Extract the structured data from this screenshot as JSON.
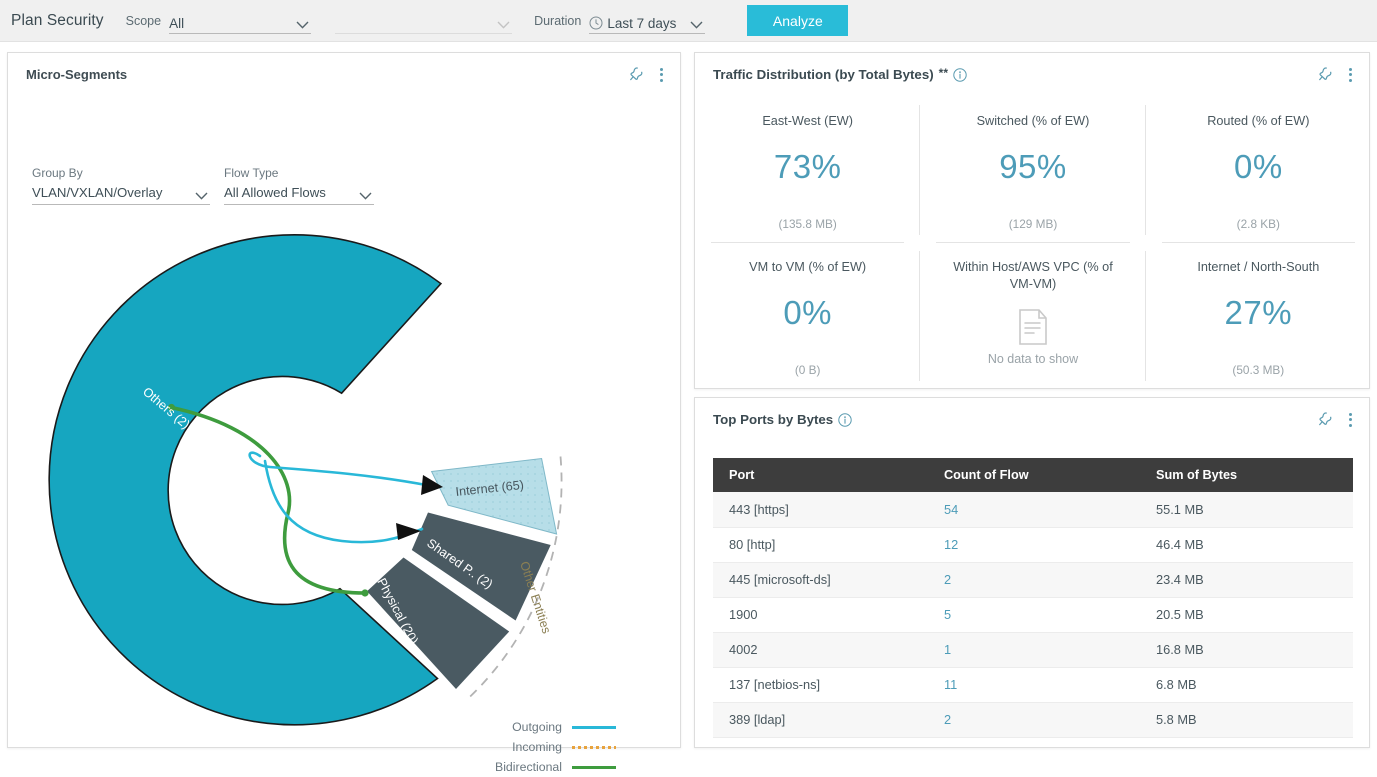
{
  "topbar": {
    "title": "Plan Security",
    "scope_label": "Scope",
    "scope_value": "All",
    "scope_secondary_value": "",
    "duration_label": "Duration",
    "duration_value": "Last 7 days",
    "analyze_label": "Analyze"
  },
  "microsegments": {
    "title": "Micro-Segments",
    "group_by_label": "Group By",
    "group_by_value": "VLAN/VXLAN/Overlay",
    "flow_type_label": "Flow Type",
    "flow_type_value": "All Allowed Flows",
    "outer_ring_label": "Other Entities",
    "legend": [
      {
        "label": "Outgoing",
        "color": "#29b8d8",
        "style": "solid"
      },
      {
        "label": "Incoming",
        "color": "#e8a33d",
        "style": "dashed"
      },
      {
        "label": "Bidirectional",
        "color": "#3e9c3e",
        "style": "solid"
      }
    ],
    "chart_data": {
      "type": "pie",
      "title": "Micro-Segments",
      "segments": [
        {
          "label": "Others (2)",
          "name": "Others",
          "count": 2,
          "value": 255,
          "color": "#16a6c0",
          "text_color": "#ffffff",
          "ring": "inner"
        },
        {
          "label": "Internet (65)",
          "name": "Internet",
          "count": 65,
          "value": 33,
          "color": "#b7dee8",
          "text_color": "#4a585f",
          "ring": "outer"
        },
        {
          "label": "Shared P.. (2)",
          "name": "Shared P..",
          "count": 2,
          "value": 36,
          "color": "#4a5a62",
          "text_color": "#ffffff",
          "ring": "outer"
        },
        {
          "label": "Physical (20)",
          "name": "Physical",
          "count": 20,
          "value": 36,
          "color": "#4a5a62",
          "text_color": "#ffffff",
          "ring": "outer"
        }
      ],
      "flows": [
        {
          "from": "Others",
          "to": "Internet",
          "type": "Outgoing",
          "color": "#29b8d8"
        },
        {
          "from": "Others",
          "to": "Shared P..",
          "type": "Outgoing",
          "color": "#29b8d8"
        },
        {
          "from": "Others",
          "to": "Physical",
          "type": "Bidirectional",
          "color": "#3e9c3e"
        }
      ]
    }
  },
  "traffic": {
    "title": "Traffic Distribution (by Total Bytes)",
    "title_suffix": "**",
    "cells": [
      {
        "label": "East-West (EW)",
        "value": "73%",
        "sub": "(135.8 MB)",
        "empty": false
      },
      {
        "label": "Switched (% of EW)",
        "value": "95%",
        "sub": "(129 MB)",
        "empty": false
      },
      {
        "label": "Routed (% of EW)",
        "value": "0%",
        "sub": "(2.8 KB)",
        "empty": false
      },
      {
        "label": "VM to VM (% of EW)",
        "value": "0%",
        "sub": "(0 B)",
        "empty": false
      },
      {
        "label": "Within Host/AWS VPC (% of VM-VM)",
        "value": "",
        "sub": "",
        "empty": true,
        "empty_text": "No data to show"
      },
      {
        "label": "Internet / North-South",
        "value": "27%",
        "sub": "(50.3 MB)",
        "empty": false
      }
    ]
  },
  "ports": {
    "title": "Top Ports by Bytes",
    "columns": [
      "Port",
      "Count of Flow",
      "Sum of Bytes"
    ],
    "rows": [
      {
        "port": "443 [https]",
        "count": "54",
        "bytes": "55.1 MB"
      },
      {
        "port": "80 [http]",
        "count": "12",
        "bytes": "46.4 MB"
      },
      {
        "port": "445 [microsoft-ds]",
        "count": "2",
        "bytes": "23.4 MB"
      },
      {
        "port": "1900",
        "count": "5",
        "bytes": "20.5 MB"
      },
      {
        "port": "4002",
        "count": "1",
        "bytes": "16.8 MB"
      },
      {
        "port": "137 [netbios-ns]",
        "count": "11",
        "bytes": "6.8 MB"
      },
      {
        "port": "389 [ldap]",
        "count": "2",
        "bytes": "5.8 MB"
      }
    ]
  },
  "colors": {
    "accent": "#29bcd8",
    "teal": "#16a6c0",
    "slate": "#4a5a62",
    "light_blue": "#b7dee8",
    "stat_blue": "#4d9cb8",
    "table_header": "#3d3d3d"
  }
}
